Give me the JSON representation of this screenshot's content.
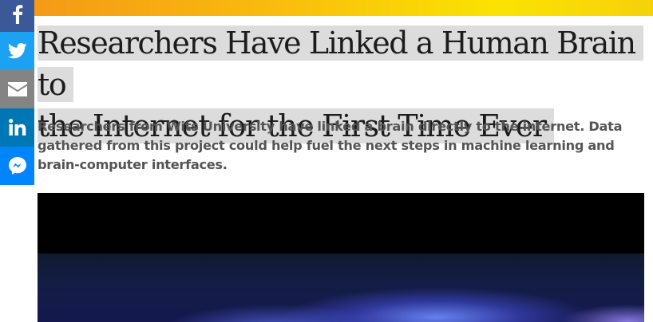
{
  "share": {
    "items": [
      {
        "icon": "facebook-icon",
        "color": "#3b5998"
      },
      {
        "icon": "twitter-icon",
        "color": "#1da1f2"
      },
      {
        "icon": "email-icon",
        "color": "#848484"
      },
      {
        "icon": "linkedin-icon",
        "color": "#0077b5"
      },
      {
        "icon": "messenger-icon",
        "color": "#0084ff"
      }
    ]
  },
  "colors": {
    "accent_bar_start": "#f49a16",
    "accent_bar_end": "#fbe300",
    "headline_highlight": "#dcdcdc",
    "headline_text": "#1c1c1c",
    "dek_text": "#555555"
  },
  "article": {
    "title_line1": "Researchers Have Linked a Human Brain to",
    "title_line2": "the Internet for the First Time Ever",
    "dek": "Researchers from Wits University have linked a brain directly to the internet. Data gathered from this project could help fuel the next steps in machine learning and brain-computer interfaces."
  }
}
